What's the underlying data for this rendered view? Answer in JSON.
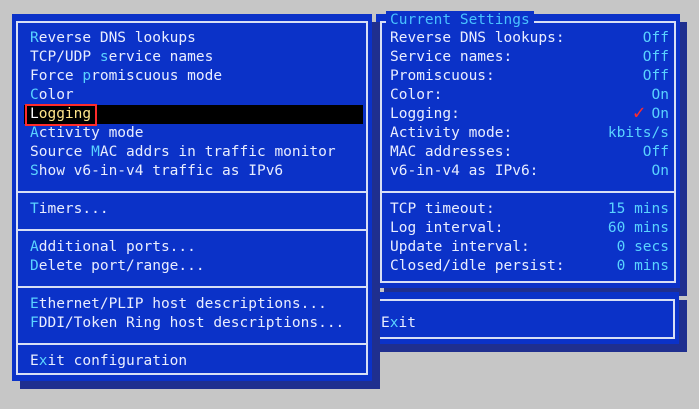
{
  "menu": {
    "items": [
      {
        "hot": "R",
        "rest": "everse DNS lookups",
        "pre": ""
      },
      {
        "pre": "TCP/UDP ",
        "hot": "s",
        "rest": "ervice names"
      },
      {
        "pre": "Force ",
        "hot": "p",
        "rest": "romiscuous mode"
      },
      {
        "pre": "",
        "hot": "C",
        "rest": "olor"
      },
      {
        "pre": "",
        "hot": "L",
        "rest": "ogging"
      },
      {
        "pre": "",
        "hot": "A",
        "rest": "ctivity mode"
      },
      {
        "pre": "Source ",
        "hot": "M",
        "rest": "AC addrs in traffic monitor"
      },
      {
        "pre": "",
        "hot": "S",
        "rest": "how v6-in-v4 traffic as IPv6"
      },
      {
        "pre": "",
        "hot": "T",
        "rest": "imers..."
      },
      {
        "pre": "",
        "hot": "A",
        "rest": "dditional ports..."
      },
      {
        "pre": "",
        "hot": "D",
        "rest": "elete port/range..."
      },
      {
        "pre": "",
        "hot": "E",
        "rest": "thernet/PLIP host descriptions..."
      },
      {
        "pre": "",
        "hot": "F",
        "rest": "DDI/Token Ring host descriptions..."
      },
      {
        "pre": "E",
        "hot": "x",
        "rest": "it configuration"
      }
    ]
  },
  "settings": {
    "title": "Current Settings",
    "rows": [
      {
        "label": "Reverse DNS lookups:",
        "value": "Off"
      },
      {
        "label": "Service names:",
        "value": "Off"
      },
      {
        "label": "Promiscuous:",
        "value": "Off"
      },
      {
        "label": "Color:",
        "value": "On"
      },
      {
        "label": "Logging:",
        "value": "On"
      },
      {
        "label": "Activity mode:",
        "value": "kbits/s"
      },
      {
        "label": "MAC addresses:",
        "value": "Off"
      },
      {
        "label": "v6-in-v4 as IPv6:",
        "value": "On"
      }
    ],
    "timers": [
      {
        "label": "TCP timeout:",
        "value": "15 mins"
      },
      {
        "label": "Log interval:",
        "value": "60 mins"
      },
      {
        "label": "Update interval:",
        "value": "0 secs"
      },
      {
        "label": "Closed/idle persist:",
        "value": "0 mins"
      }
    ],
    "check_mark": "✓"
  },
  "exit_window": {
    "pre": "E",
    "hot": "x",
    "rest": "it"
  },
  "colors": {
    "window_bg": "#0b32c8",
    "hotkey": "#5ad3ff",
    "selection_bar": "#000000",
    "highlight_box": "#ff2b2b"
  }
}
